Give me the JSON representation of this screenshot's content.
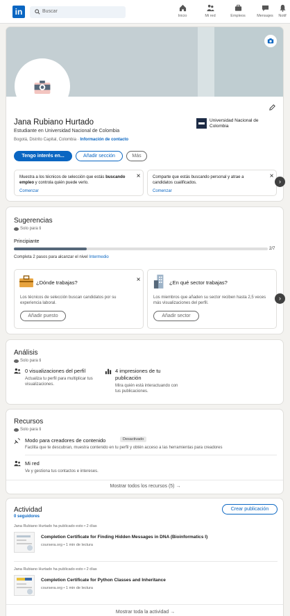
{
  "nav": {
    "logo": "in",
    "search_placeholder": "Buscar",
    "items": [
      {
        "label": "Inicio",
        "icon": "home-icon"
      },
      {
        "label": "Mi red",
        "icon": "network-icon"
      },
      {
        "label": "Empleos",
        "icon": "briefcase-icon"
      },
      {
        "label": "Mensajes",
        "icon": "messaging-icon"
      },
      {
        "label": "Notif",
        "icon": "bell-icon"
      }
    ]
  },
  "profile": {
    "name": "Jana Rubiano Hurtado",
    "headline": "Estudiante en Universidad Nacional de Colombia",
    "location": "Bogotá, Distrito Capital, Colombia",
    "location_sep": " · ",
    "contact_link": "Información de contacto",
    "university": "Universidad Nacional de Colombia",
    "buttons": {
      "open_to": "Tengo interés en...",
      "add_section": "Añadir sección",
      "more": "Más"
    },
    "info_left": {
      "text_a": "Muestra a los técnicos de selección que estás ",
      "text_bold": "buscando empleo",
      "text_b": " y controla quién puede verlo.",
      "link": "Comenzar"
    },
    "info_right": {
      "text": "Comparte que estás buscando personal y atrae a candidatos cualificados.",
      "link": "Comenzar"
    }
  },
  "suggestions": {
    "title": "Sugerencias",
    "private": "Solo para ti",
    "level": "Principiante",
    "progress_label": "2/7",
    "progress_fraction": 0.286,
    "steps_text": "Completa 2 pasos para alcanzar el nivel ",
    "steps_link": "Intermedio",
    "card_left": {
      "title": "¿Dónde trabajas?",
      "body": "Los técnicos de selección buscan candidatos por su experiencia laboral.",
      "button": "Añadir puesto"
    },
    "card_right": {
      "title": "¿En qué sector trabajas?",
      "body": "Los miembros que añaden su sector reciben hasta 2,5 veces más visualizaciones del perfil.",
      "button": "Añadir sector"
    }
  },
  "analysis": {
    "title": "Análisis",
    "private": "Solo para ti",
    "views_title": "0 visualizaciones del perfil",
    "views_body": "Actualiza tu perfil para multiplicar tus visualizaciones.",
    "impressions_title": "4 impresiones de tu publicación",
    "impressions_body": "Mira quién está interactuando con tus publicaciones."
  },
  "resources": {
    "title": "Recursos",
    "private": "Solo para ti",
    "creator_title": "Modo para creadores de contenido",
    "creator_badge": "Desactivado",
    "creator_body": "Facilita que te descubran, muestra contenido en tu perfil y obtén acceso a las herramientas para creadores",
    "network_title": "Mi red",
    "network_body": "Ve y gestiona tus contactos e intereses.",
    "show_all": "Mostrar todos los recursos (5)"
  },
  "activity": {
    "title": "Actividad",
    "followers": "0 seguidores",
    "create_post": "Crear publicación",
    "posts": [
      {
        "author": "Jana Rubiano Hurtado",
        "meta": " ha publicado esto • 2 días",
        "title": "Completion Certificate for Finding Hidden Messages in DNA (Bioinformatics I)",
        "source": "coursera.org • 1 min de lectura"
      },
      {
        "author": "Jana Rubiano Hurtado",
        "meta": " ha publicado esto • 2 días",
        "title": "Completion Certificate for Python Classes and Inheritance",
        "source": "coursera.org • 1 min de lectura"
      }
    ],
    "show_all": "Mostrar toda la actividad"
  }
}
